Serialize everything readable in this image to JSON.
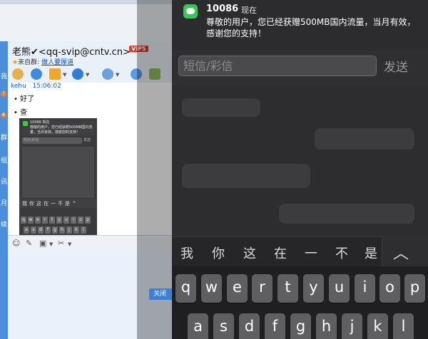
{
  "chat": {
    "contact_name": "老熊✔<qq-svip@cntv.cn>",
    "vip_label": "VIP5",
    "from_group_label": "来自群:",
    "group_name": "做人要厚道",
    "sender": "kehu",
    "sent_time": "15:06:02",
    "messages": [
      "好了",
      "查"
    ],
    "strip_labels": [
      "我",
      "群",
      "组",
      "讯",
      "月",
      "续",
      "约"
    ],
    "strip_badges": [
      "7",
      "8"
    ],
    "close_label": "关闭",
    "thumbnail": {
      "notif_title": "10086 现在",
      "notif_text": "尊敬的用户，您已经获赠500MB国内流量，当月有效，感谢您的支持！",
      "input_placeholder": "短信/彩信",
      "send_label": "发送",
      "suggestion_row": "我你这在一不是^",
      "row1": [
        "q",
        "w",
        "e",
        "r",
        "t",
        "y",
        "u",
        "i",
        "o",
        "p"
      ],
      "row2": [
        "a",
        "s",
        "d",
        "f",
        "g",
        "h",
        "j",
        "k",
        "l"
      ]
    }
  },
  "phone": {
    "notification": {
      "app_icon": "message-icon",
      "sender": "10086",
      "time": "现在",
      "body": "尊敬的用户，您已经获赠500MB国内流量，当月有效，感谢您的支持！"
    },
    "compose": {
      "placeholder": "短信/彩信",
      "send_label": "发送"
    },
    "suggestions": [
      "我",
      "你",
      "这",
      "在",
      "一",
      "不",
      "是"
    ],
    "keyboard": {
      "row1": [
        "q",
        "w",
        "e",
        "r",
        "t",
        "y",
        "u",
        "i",
        "o",
        "p"
      ],
      "row2": [
        "a",
        "s",
        "d",
        "f",
        "g",
        "h",
        "j",
        "k",
        "l"
      ]
    }
  },
  "colors": {
    "accent_blue": "#4a8fdc",
    "sms_green": "#35c759",
    "vip_red": "#d93a2b"
  }
}
